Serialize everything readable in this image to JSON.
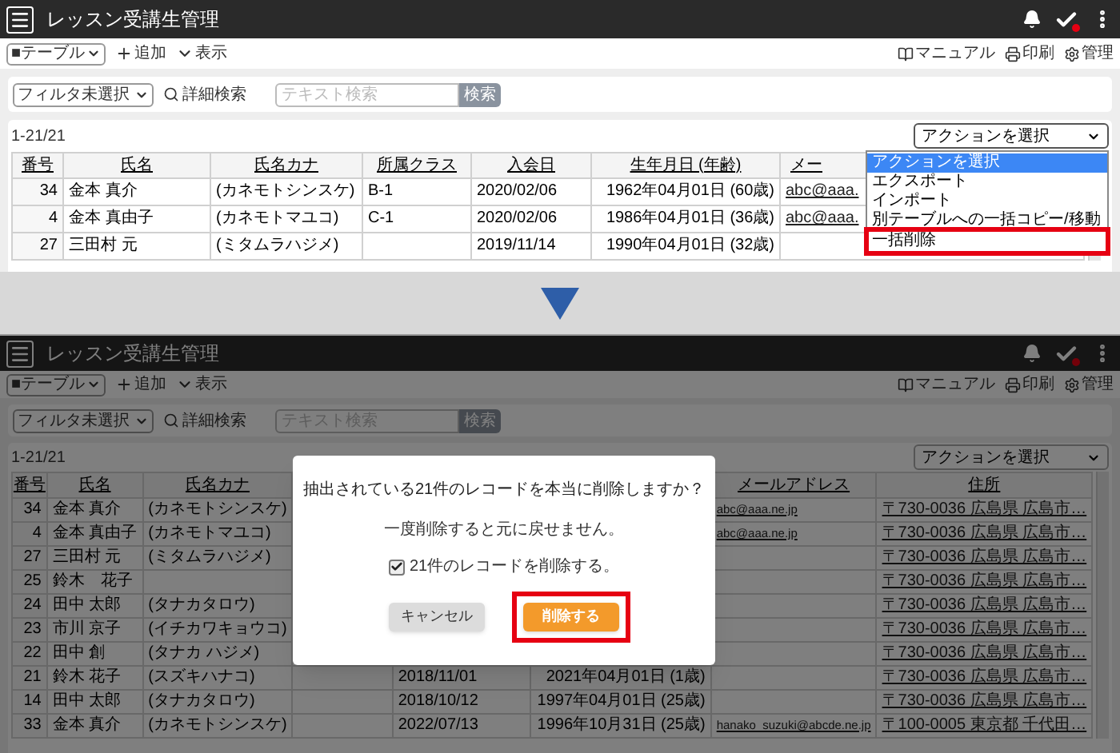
{
  "before": {
    "window_title": "レッスン受講生管理",
    "toolbar": {
      "view_select": "■テーブル",
      "add": "追加",
      "display": "表示",
      "manual": "マニュアル",
      "print": "印刷",
      "admin": "管理"
    },
    "filter": {
      "select": "フィルタ未選択",
      "advanced_search": "詳細検索",
      "search_placeholder": "テキスト検索",
      "search_button": "検索"
    },
    "count": "1-21/21",
    "action_select": {
      "value": "アクションを選択",
      "expanded": true,
      "options": [
        {
          "label": "アクションを選択",
          "selected": true,
          "annotated": false
        },
        {
          "label": "エクスポート",
          "selected": false,
          "annotated": false
        },
        {
          "label": "インポート",
          "selected": false,
          "annotated": false
        },
        {
          "label": "別テーブルへの一括コピー/移動",
          "selected": false,
          "annotated": false
        },
        {
          "label": "一括削除",
          "selected": false,
          "annotated": true
        }
      ]
    },
    "table": {
      "columns": {
        "no": "番号",
        "name": "氏名",
        "kana": "氏名カナ",
        "class": "所属クラス",
        "joined": "入会日",
        "birth": "生年月日 (年齢)",
        "email": "メー"
      },
      "rows": [
        {
          "no": "34",
          "name": "金本 真介",
          "kana": "(カネモトシンスケ)",
          "class": "B-1",
          "joined": "2020/02/06",
          "birth": "1962年04月01日 (60歳)",
          "email": "abc@aaa."
        },
        {
          "no": "4",
          "name": "金本 真由子",
          "kana": "(カネモトマユコ)",
          "class": "C-1",
          "joined": "2020/02/06",
          "birth": "1986年04月01日 (36歳)",
          "email": "abc@aaa."
        },
        {
          "no": "27",
          "name": "三田村 元",
          "kana": "(ミタムラハジメ)",
          "joined": "2019/11/14",
          "birth": "1990年04月01日 (32歳)"
        }
      ]
    }
  },
  "after": {
    "window_title": "レッスン受講生管理",
    "toolbar": {
      "view_select": "■テーブル",
      "add": "追加",
      "display": "表示",
      "manual": "マニュアル",
      "print": "印刷",
      "admin": "管理"
    },
    "filter": {
      "select": "フィルタ未選択",
      "advanced_search": "詳細検索",
      "search_placeholder": "テキスト検索",
      "search_button": "検索"
    },
    "count": "1-21/21",
    "action_select": {
      "value": "アクションを選択",
      "expanded": false
    },
    "table": {
      "columns": {
        "no": "番号",
        "name": "氏名",
        "kana": "氏名カナ",
        "email": "メールアドレス",
        "address": "住所"
      },
      "rows": [
        {
          "no": "34",
          "name": "金本 真介",
          "kana": "(カネモトシンスケ)",
          "email": "abc@aaa.ne.jp",
          "address": "〒730-0036 広島県 広島市…"
        },
        {
          "no": "4",
          "name": "金本 真由子",
          "kana": "(カネモトマユコ)",
          "email": "abc@aaa.ne.jp",
          "address": "〒730-0036 広島県 広島市…"
        },
        {
          "no": "27",
          "name": "三田村 元",
          "kana": "(ミタムラハジメ)",
          "address": "〒730-0036 広島県 広島市…"
        },
        {
          "no": "25",
          "name": "鈴木　花子",
          "address": "〒730-0036 広島県 広島市…"
        },
        {
          "no": "24",
          "name": "田中 太郎",
          "kana": "(タナカタロウ)",
          "address": "〒730-0036 広島県 広島市…"
        },
        {
          "no": "23",
          "name": "市川 京子",
          "kana": "(イチカワキョウコ)",
          "address": "〒730-0036 広島県 広島市…"
        },
        {
          "no": "22",
          "name": "田中 創",
          "kana": "(タナカ ハジメ)",
          "address": "〒730-0036 広島県 広島市…"
        },
        {
          "no": "21",
          "name": "鈴木 花子",
          "kana": "(スズキハナコ)",
          "joined": "2018/11/01",
          "birth": "2021年04月01日 (1歳)",
          "address": "〒730-0036 広島県 広島市…"
        },
        {
          "no": "14",
          "name": "田中 太郎",
          "kana": "(タナカタロウ)",
          "joined": "2018/10/12",
          "birth": "1997年04月01日 (25歳)",
          "address": "〒730-0036 広島県 広島市…"
        },
        {
          "no": "33",
          "name": "金本 真介",
          "kana": "(カネモトシンスケ)",
          "joined": "2022/07/13",
          "birth": "1996年10月31日 (25歳)",
          "email": "hanako_suzuki@abcde.ne.jp",
          "address": "〒100-0005 東京都 千代田…"
        }
      ]
    },
    "dialog": {
      "title": "抽出されている21件のレコードを本当に削除しますか？",
      "note": "一度削除すると元に戻せません。",
      "checkbox": {
        "label": "21件のレコードを削除する。",
        "checked": true
      },
      "buttons": [
        {
          "label": "キャンセル",
          "kind": "secondary",
          "annotated": false
        },
        {
          "label": "削除する",
          "kind": "primary",
          "annotated": true
        }
      ]
    }
  }
}
